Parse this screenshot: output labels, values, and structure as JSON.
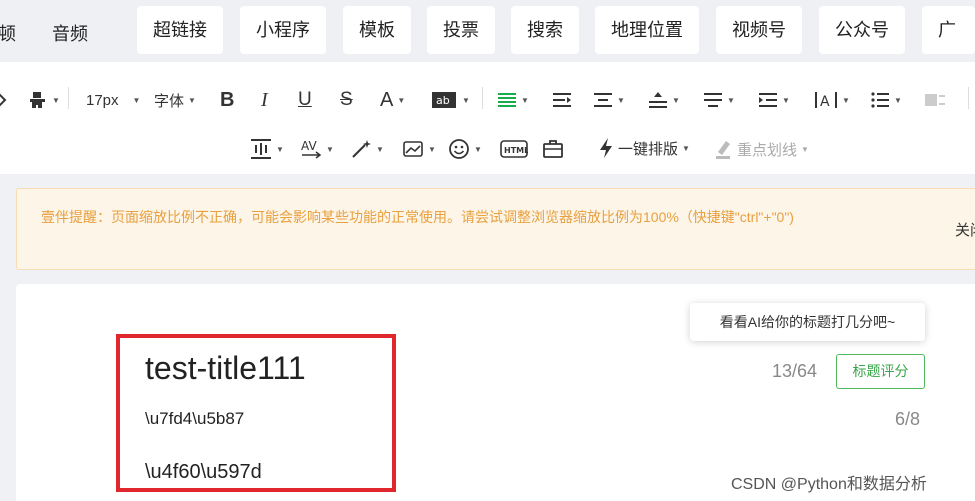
{
  "tabs": [
    "顿",
    "音频",
    "超链接",
    "小程序",
    "模板",
    "投票",
    "搜索",
    "地理位置",
    "视频号",
    "公众号",
    "广告"
  ],
  "toolbar": {
    "font_size": "17px",
    "font_family": "字体",
    "one_click_layout": "一键排版",
    "highlight": "重点划线"
  },
  "notice": {
    "text": "壹伴提醒：页面缩放比例不正确，可能会影响某些功能的正常使用。请尝试调整浏览器缩放比例为100%（快捷键\"ctrl\"+\"0\")",
    "close": "关闭"
  },
  "editor": {
    "title": "test-title111",
    "line1": "\\u7fd4\\u5b87",
    "line2": "\\u4f60\\u597d",
    "ai_tooltip": "看看AI给你的标题打几分吧~",
    "title_count": "13/64",
    "score_button": "标题评分",
    "line_count": "6/8"
  },
  "watermark": "CSDN @Python和数据分析",
  "colors": {
    "highlight_box": "#e0272d",
    "notice_text": "#e8a040",
    "score_green": "#3aa54a",
    "align_green": "#1aab4a"
  }
}
